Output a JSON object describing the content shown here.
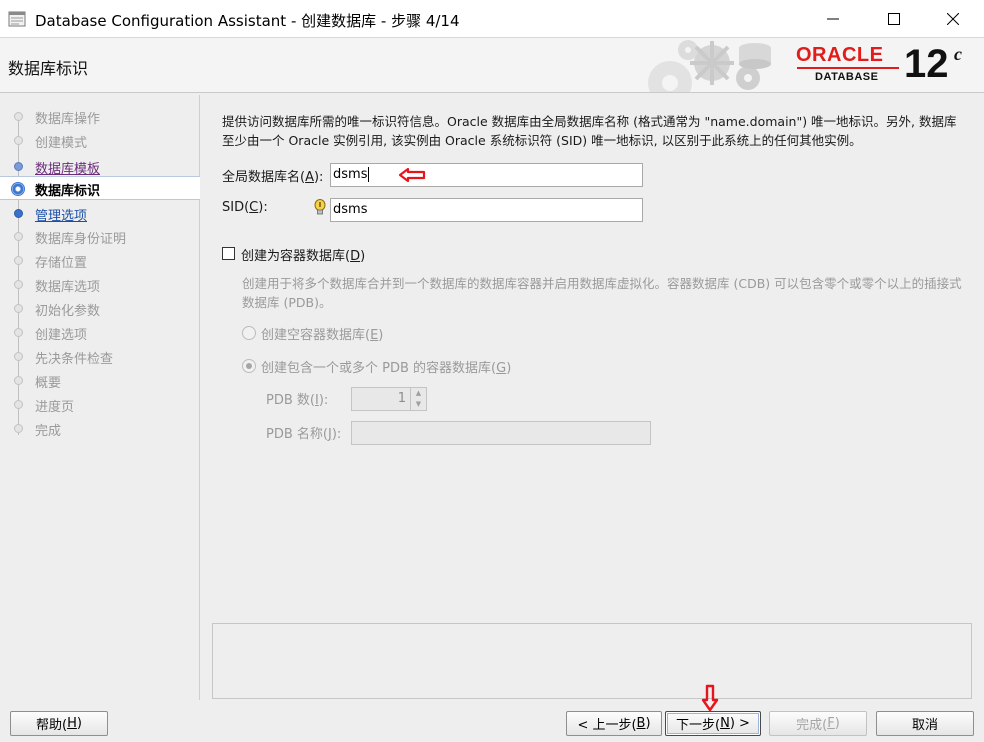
{
  "window": {
    "title": "Database Configuration Assistant - 创建数据库 - 步骤 4/14",
    "minimize_icon": "minimize-icon",
    "maximize_icon": "maximize-icon",
    "close_icon": "close-icon"
  },
  "banner": {
    "page_title": "数据库标识",
    "logo_brand": "ORACLE",
    "logo_product": "DATABASE",
    "logo_version": "12",
    "logo_version_suffix": "c"
  },
  "steps": [
    {
      "label": "数据库操作",
      "state": "disabled"
    },
    {
      "label": "创建模式",
      "state": "disabled"
    },
    {
      "label": "数据库模板",
      "state": "visited"
    },
    {
      "label": "数据库标识",
      "state": "current"
    },
    {
      "label": "管理选项",
      "state": "link"
    },
    {
      "label": "数据库身份证明",
      "state": "disabled"
    },
    {
      "label": "存储位置",
      "state": "disabled"
    },
    {
      "label": "数据库选项",
      "state": "disabled"
    },
    {
      "label": "初始化参数",
      "state": "disabled"
    },
    {
      "label": "创建选项",
      "state": "disabled"
    },
    {
      "label": "先决条件检查",
      "state": "disabled"
    },
    {
      "label": "概要",
      "state": "disabled"
    },
    {
      "label": "进度页",
      "state": "disabled"
    },
    {
      "label": "完成",
      "state": "disabled"
    }
  ],
  "form": {
    "description": "提供访问数据库所需的唯一标识符信息。Oracle 数据库由全局数据库名称 (格式通常为 \"name.domain\") 唯一地标识。另外, 数据库至少由一个 Oracle 实例引用, 该实例由 Oracle 系统标识符 (SID) 唯一地标识, 以区别于此系统上的任何其他实例。",
    "global_db_name": {
      "label_pre": "全局数据库名(",
      "mnemonic": "A",
      "label_post": "):",
      "value": "dsms"
    },
    "sid": {
      "label_pre": "SID(",
      "mnemonic": "C",
      "label_post": "):",
      "value": "dsms"
    },
    "container": {
      "checkbox_label_pre": "创建为容器数据库(",
      "checkbox_mnemonic": "D",
      "checkbox_label_post": ")",
      "checked": false,
      "description": "创建用于将多个数据库合并到一个数据库的数据库容器并启用数据库虚拟化。容器数据库 (CDB) 可以包含零个或零个以上的插接式数据库 (PDB)。",
      "radio_empty": {
        "label_pre": "创建空容器数据库(",
        "mnemonic": "E",
        "label_post": ")",
        "selected": false
      },
      "radio_with_pdb": {
        "label_pre": "创建包含一个或多个 PDB 的容器数据库(",
        "mnemonic": "G",
        "label_post": ")",
        "selected": true
      },
      "pdb_count": {
        "label_pre": "PDB 数(",
        "mnemonic": "I",
        "label_post": "):",
        "value": "1"
      },
      "pdb_name": {
        "label_pre": "PDB 名称(",
        "mnemonic": "J",
        "label_post": "):",
        "value": ""
      }
    }
  },
  "buttons": {
    "help": {
      "label_pre": "帮助(",
      "mnemonic": "H",
      "label_post": ")"
    },
    "back": {
      "label_pre": "< 上一步(",
      "mnemonic": "B",
      "label_post": ")"
    },
    "next": {
      "label_pre": "下一步(",
      "mnemonic": "N",
      "label_post": ") >"
    },
    "finish": {
      "label_pre": "完成(",
      "mnemonic": "F",
      "label_post": ")"
    },
    "cancel": {
      "label": "取消"
    }
  },
  "colors": {
    "annotation_arrow": "#e8141c",
    "oracle_red": "#e21b1b",
    "link_blue": "#1c4fa8",
    "visited_purple": "#6b2e7a"
  }
}
